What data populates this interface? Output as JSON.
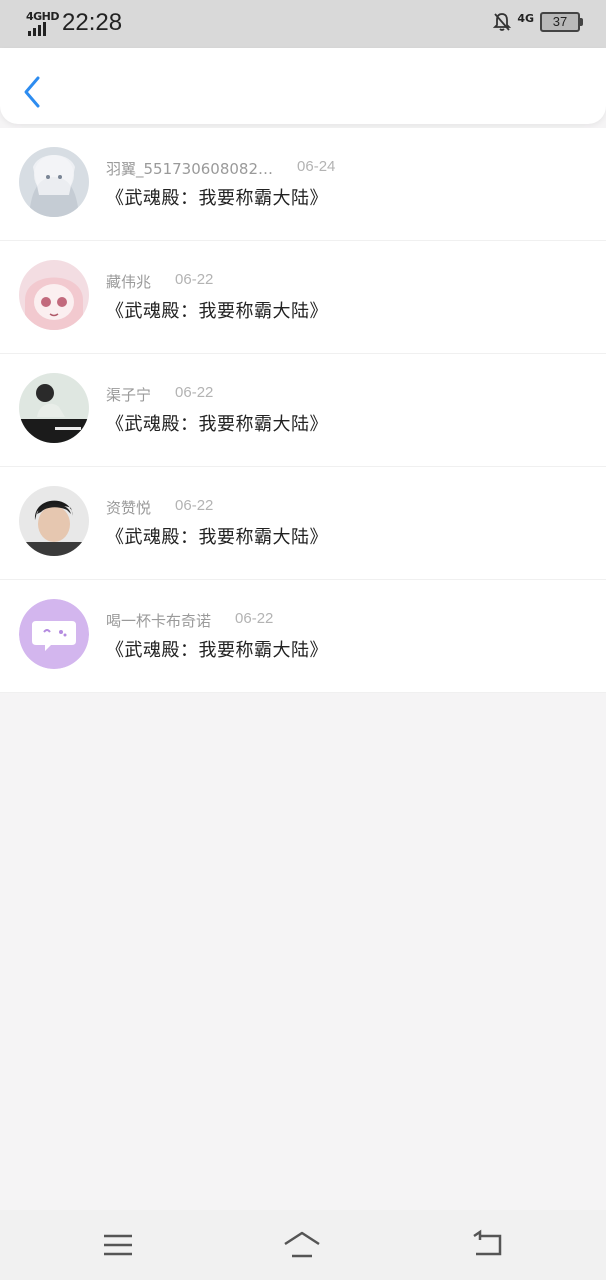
{
  "status_bar": {
    "network": "4GHD",
    "time": "22:28",
    "network_right": "4G",
    "battery": "37"
  },
  "header": {
    "back_icon": "chevron-left-icon"
  },
  "list": [
    {
      "name": "羽翼_551730608082…",
      "date": "06-24",
      "title": "《武魂殿：我要称霸大陆》"
    },
    {
      "name": "藏伟兆",
      "date": "06-22",
      "title": "《武魂殿：我要称霸大陆》"
    },
    {
      "name": "渠子宁",
      "date": "06-22",
      "title": "《武魂殿：我要称霸大陆》"
    },
    {
      "name": "资赞悦",
      "date": "06-22",
      "title": "《武魂殿：我要称霸大陆》"
    },
    {
      "name": "喝一杯卡布奇诺",
      "date": "06-22",
      "title": "《武魂殿：我要称霸大陆》"
    }
  ],
  "nav": {
    "menu_icon": "menu-icon",
    "home_icon": "home-icon",
    "back_icon": "back-icon"
  },
  "colors": {
    "accent": "#2d8cf0",
    "background": "#f5f4f5"
  }
}
